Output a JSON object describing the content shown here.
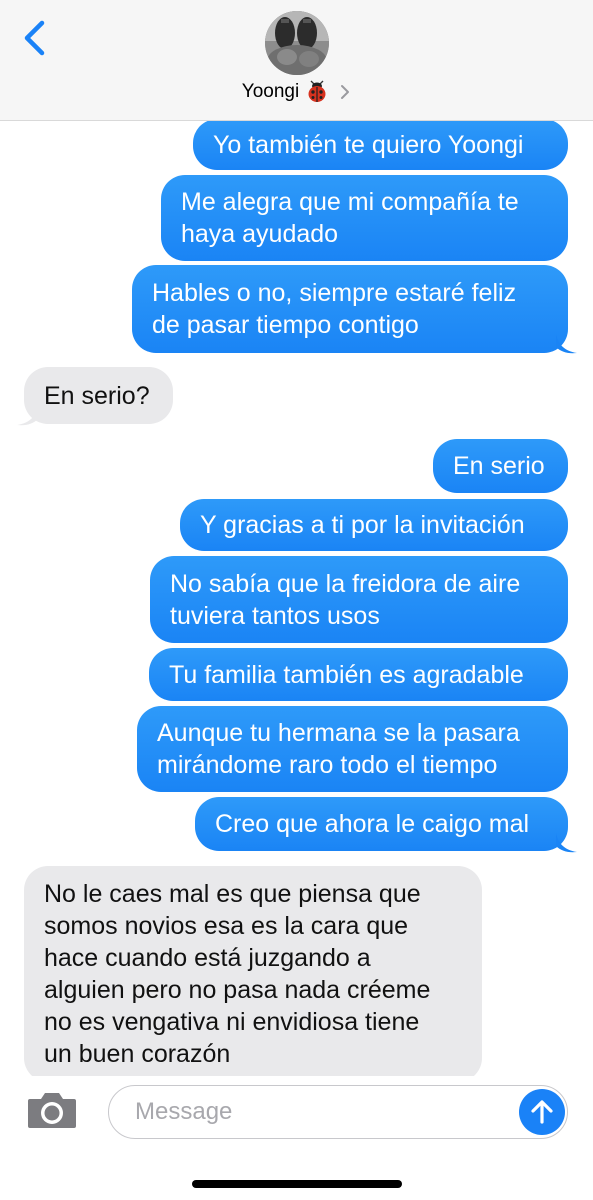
{
  "header": {
    "contact_name": "Yoongi",
    "contact_emoji_icon": "ladybug-icon"
  },
  "messages": [
    {
      "from": "me",
      "text": "Yo también te quiero Yoongi"
    },
    {
      "from": "me",
      "text": "Me alegra que mi compañía te\nhaya ayudado"
    },
    {
      "from": "me",
      "text": "Hables o no, siempre estaré feliz\nde pasar tiempo contigo"
    },
    {
      "from": "them",
      "text": "En serio?"
    },
    {
      "from": "me",
      "text": "En serio"
    },
    {
      "from": "me",
      "text": "Y gracias a ti por la invitación"
    },
    {
      "from": "me",
      "text": "No sabía que la freidora de aire\ntuviera tantos usos"
    },
    {
      "from": "me",
      "text": "Tu familia también es agradable"
    },
    {
      "from": "me",
      "text": "Aunque tu hermana se la pasara\nmirándome raro todo el tiempo"
    },
    {
      "from": "me",
      "text": "Creo que ahora le caigo mal"
    },
    {
      "from": "them",
      "text": "No le caes mal es que piensa que\nsomos novios esa es la cara que\nhace cuando está juzgando a\nalguien pero no pasa nada créeme\nno es vengativa ni envidiosa tiene\nun buen corazón"
    }
  ],
  "composer": {
    "placeholder": "Message",
    "value": ""
  },
  "colors": {
    "outgoing_bubble": "#1a84f5",
    "incoming_bubble": "#e9e9eb",
    "accent": "#1a82f7"
  }
}
